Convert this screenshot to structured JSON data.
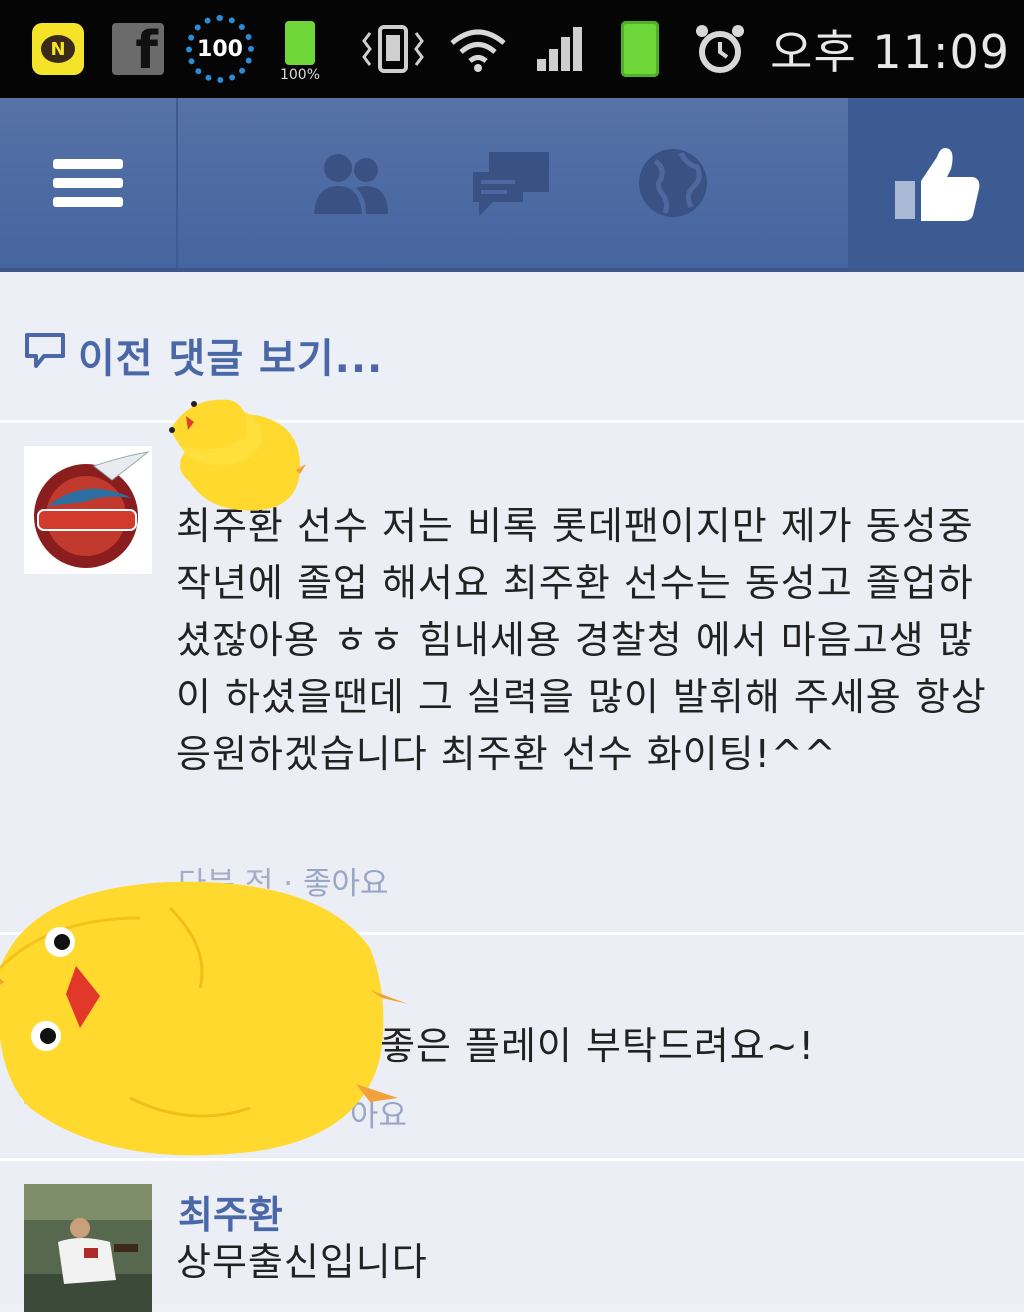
{
  "status_bar": {
    "kakao_glyph": "N",
    "facebook_glyph": "f",
    "progress_value": "100",
    "battery_small_pct": "100%",
    "time": "오후 11:09",
    "icons": [
      "kakaotalk-icon",
      "facebook-icon",
      "progress-ring-icon",
      "battery-icon",
      "vibrate-icon",
      "wifi-icon",
      "signal-icon",
      "battery-icon",
      "alarm-icon"
    ]
  },
  "app_bar": {
    "icons": [
      "menu-icon",
      "friends-icon",
      "messages-icon",
      "globe-icon",
      "like-icon"
    ],
    "accent": "#4565a0"
  },
  "comments_panel": {
    "previous_comments_label": "이전 댓글 보기...",
    "comments": [
      {
        "author": "",
        "text": "최주환 선수 저는 비록 롯데팬이지만 제가 동성중작년에 졸업 해서요 최주환 선수는 동성고 졸업하셨잖아용 ㅎㅎ 힘내세용 경찰청 에서 마음고생 많이 하셨을땐데 그 실력을 많이 발휘해 주세용 항상 응원하겠습니다 최주환 선수 화이팅!^^",
        "time": "다분 전",
        "like_label": "좋아요"
      },
      {
        "author": "",
        "text": "좋은 플레이 부탁드려요~!",
        "time": "",
        "like_label": "아요"
      },
      {
        "author": "최주환",
        "text": "상무출신입니다"
      }
    ]
  }
}
